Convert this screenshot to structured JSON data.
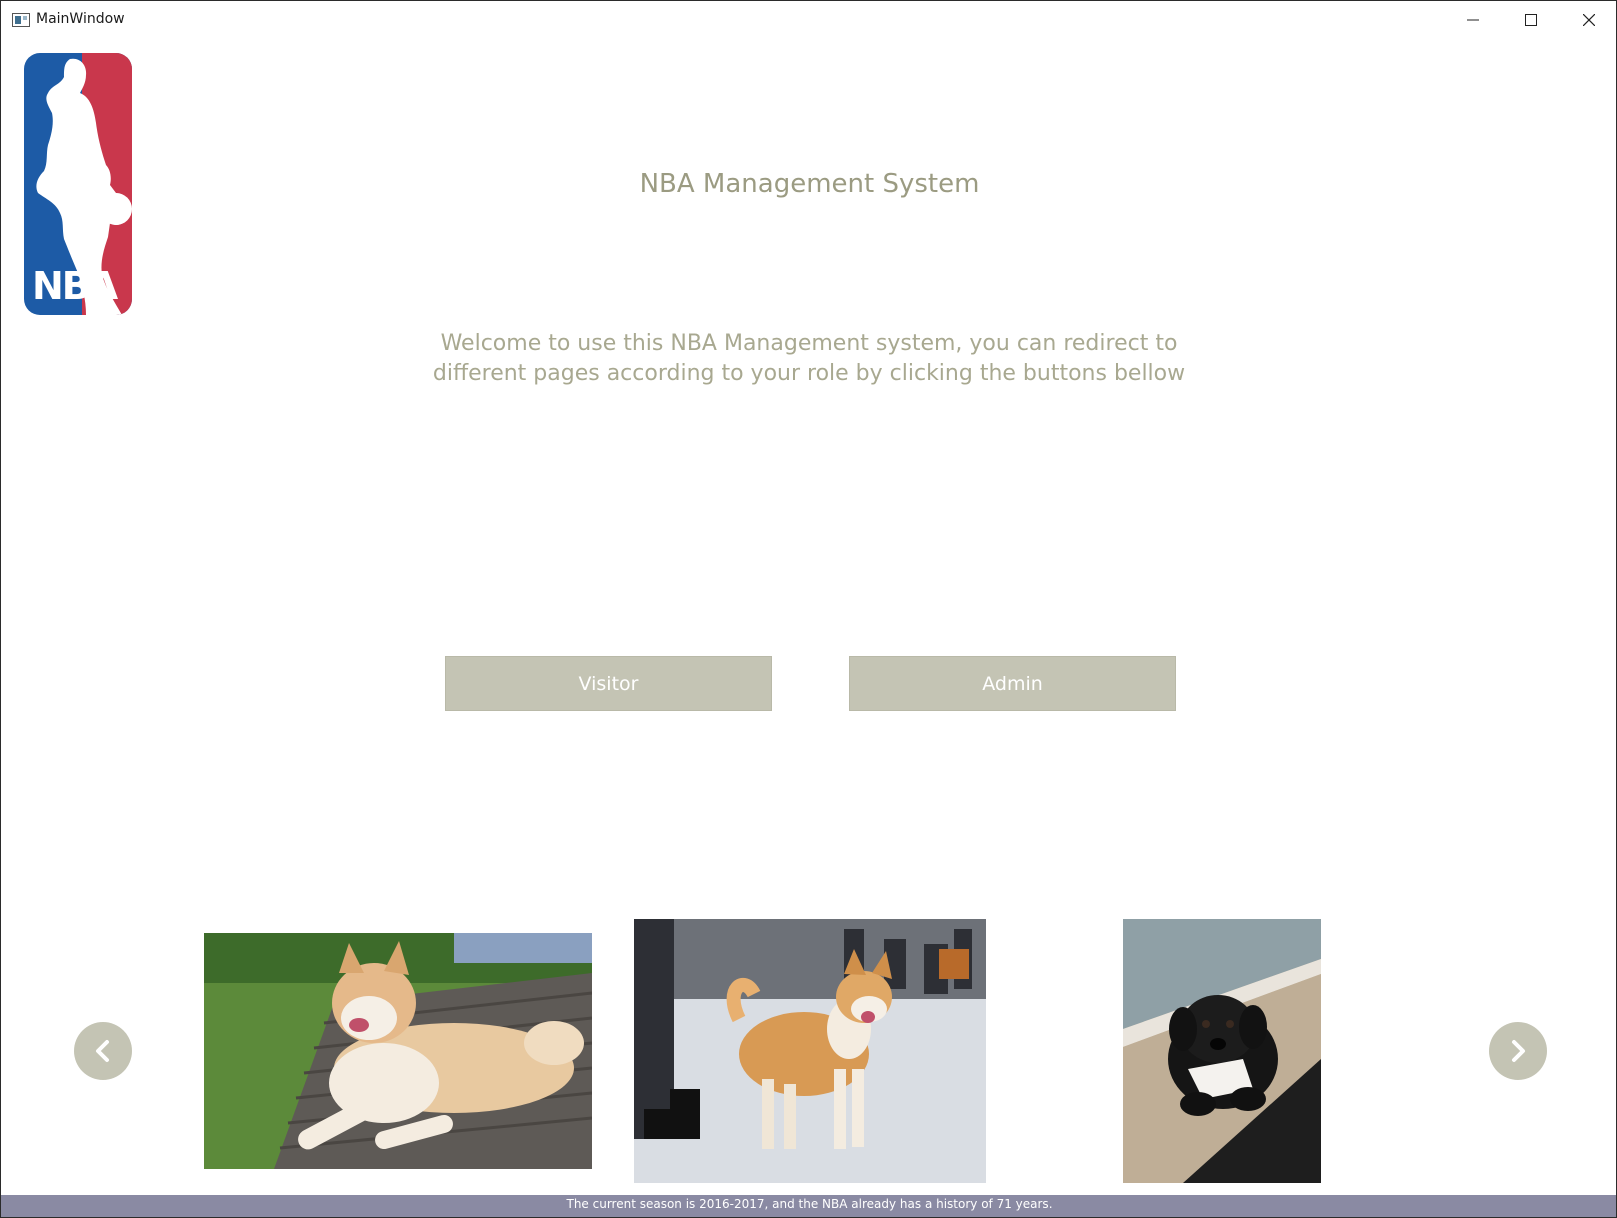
{
  "window": {
    "title": "MainWindow"
  },
  "header": {
    "title": "NBA Management System",
    "welcome_text": "Welcome to use this NBA Management system, you can redirect to different pages according to your role by clicking the buttons bellow"
  },
  "buttons": {
    "visitor_label": "Visitor",
    "admin_label": "Admin"
  },
  "carousel": {
    "prev_icon": "chevron-left-icon",
    "next_icon": "chevron-right-icon",
    "photos": [
      {
        "alt": "akita dog lying on deck"
      },
      {
        "alt": "akita dog standing on snow"
      },
      {
        "alt": "black puppy under blanket"
      }
    ]
  },
  "status": {
    "text": "The current season is 2016-2017, and the NBA already has a history of 71 years."
  },
  "colors": {
    "accent": "#c4c4b4",
    "title_text": "#9b9b82",
    "status_bar": "#8a8aa3",
    "nba_blue": "#1d5ba6",
    "nba_red": "#c9374c"
  }
}
